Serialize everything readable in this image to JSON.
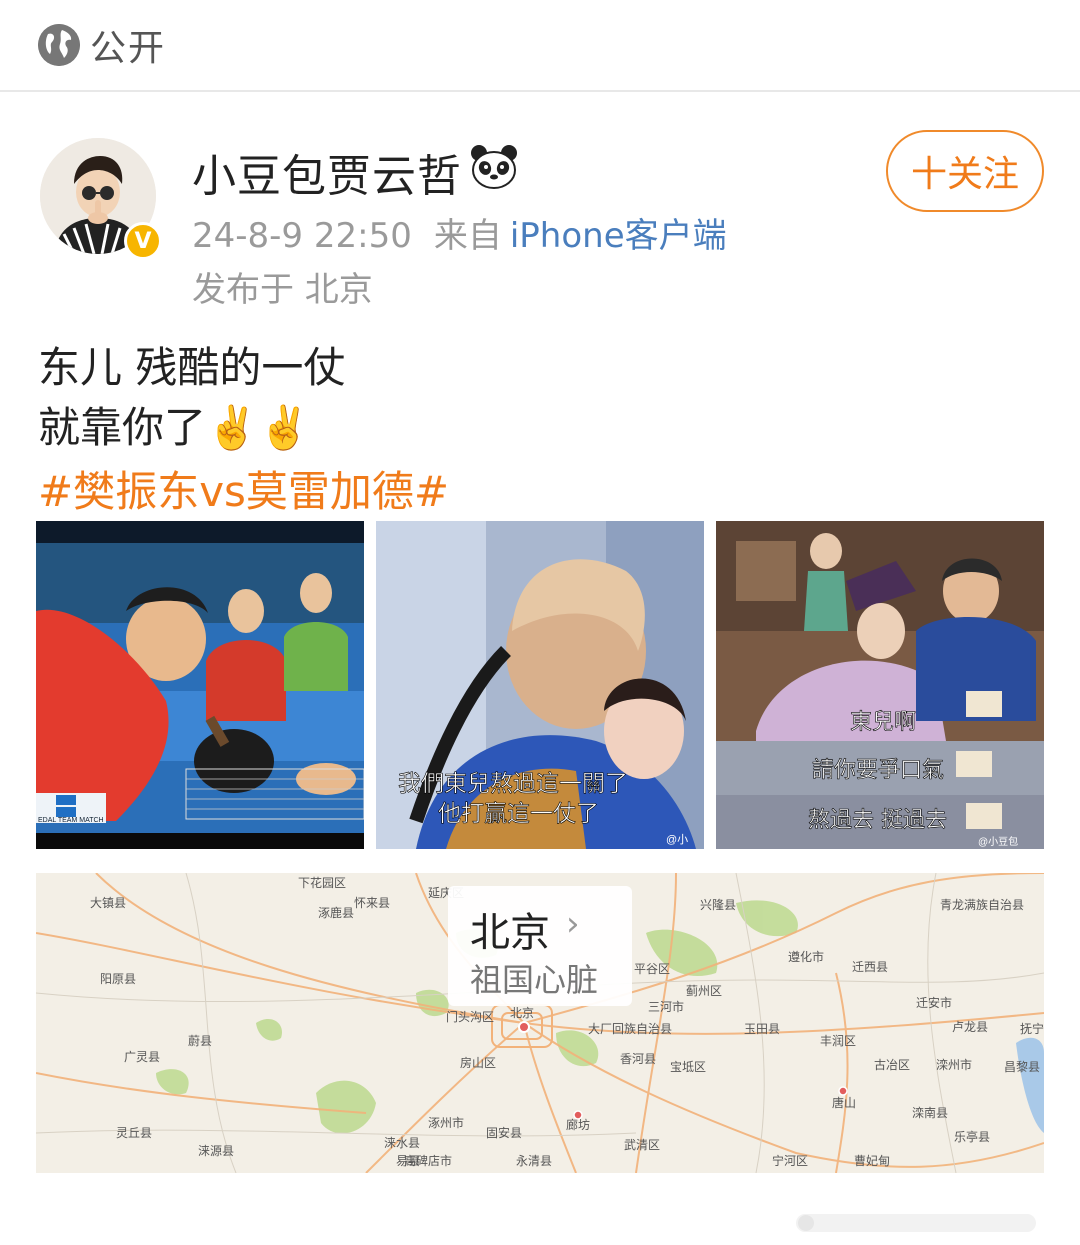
{
  "header": {
    "visibility_label": "公开",
    "icon": "globe-icon"
  },
  "post": {
    "author": {
      "name": "小豆包贾云哲",
      "emoji_icon": "panda-icon",
      "verified_icon": "verified-badge-icon",
      "verified_letter": "V"
    },
    "time": "24-8-9 22:50",
    "source_prefix": "来自",
    "source_client": "iPhone客户端",
    "location_line": "发布于 北京",
    "follow_label": "十关注",
    "text_line1": "东儿 残酷的一仗",
    "text_line2": "就靠你了✌️✌️",
    "hashtag": "#樊振东vs莫雷加德#",
    "images": [
      {
        "overlay_text": [
          "EDAL TEAM MATCH"
        ]
      },
      {
        "overlay_text": [
          "我們東兒熬過這一關了",
          "他打贏這一仗了"
        ],
        "logo": "@小"
      },
      {
        "overlay_text": [
          "東兒啊",
          "請你要爭口氣",
          "熬過去 挺過去"
        ],
        "logo": "@小豆包"
      }
    ],
    "map": {
      "title": "北京",
      "subtitle": "祖国心脏",
      "place_labels": [
        "下花园区",
        "怀来县",
        "延庆区",
        "大镇县",
        "涿鹿县",
        "阳原县",
        "蔚县",
        "广灵县",
        "灵丘县",
        "涞源县",
        "涞水县",
        "易县",
        "高碑店市",
        "涿州市",
        "固安县",
        "永清县",
        "廊坊",
        "武清区",
        "宝坻区",
        "三河市",
        "香河县",
        "大厂回族自治县",
        "蓟州区",
        "玉田县",
        "遵化市",
        "迁西县",
        "迁安市",
        "丰润区",
        "古冶区",
        "滦州市",
        "唐山",
        "滦南县",
        "乐亭县",
        "卢龙县",
        "昌黎县",
        "抚宁",
        "青龙满族自治县",
        "兴隆县",
        "平谷区",
        "门头沟区",
        "房山区",
        "北京",
        "宁河区",
        "曹妃甸"
      ],
      "colors": {
        "land": "#f3efe6",
        "green": "#bcd98e",
        "road": "#f2b27a",
        "water": "#a9c9e8"
      }
    }
  },
  "colors": {
    "accent_orange": "#f07b1a",
    "link_blue": "#4a7ebd",
    "meta_gray": "#9a9a9a",
    "verified_gold": "#f7b500"
  }
}
